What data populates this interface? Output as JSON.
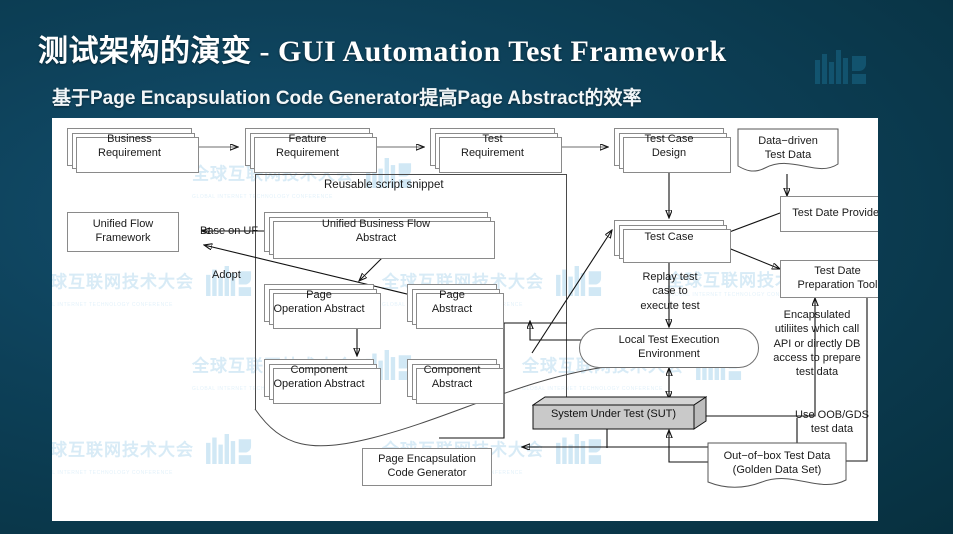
{
  "slide": {
    "title": "测试架构的演变 -  GUI Automation Test Framework",
    "subtitle": "基于Page Encapsulation Code Generator提高Page Abstract的效率",
    "background_color": "#0c3e52",
    "panel_color": "#ffffff",
    "watermark_text": "全球互联网技术大会",
    "watermark_subtext": "GLOBAL INTERNET TECHNOLOGY CONFERENCE"
  },
  "diagram": {
    "type": "flowchart",
    "group_label": "Reusable script snippet",
    "nodes": {
      "business_requirement": "Business\nRequirement",
      "feature_requirement": "Feature\nRequirement",
      "test_requirement": "Test\nRequirement",
      "test_case_design": "Test Case\nDesign",
      "data_driven_test_data": "Data−driven\nTest Data",
      "unified_flow_framework": "Unified Flow\nFramework",
      "unified_business_flow_abstract": "Unified Business Flow\nAbstract",
      "test_case": "Test Case",
      "test_date_provider": "Test Date Provider",
      "page_operation_abstract": "Page\nOperation Abstract",
      "page_abstract": "Page\nAbstract",
      "test_date_preparation_tool": "Test Date\nPreparation Tool",
      "component_operation_abstract": "Component\nOperation Abstract",
      "component_abstract": "Component\nAbstract",
      "local_test_execution_environment": "Local Test Execution\nEnvironment",
      "system_under_test": "System Under Test (SUT)",
      "page_encapsulation_code_generator": "Page Encapsulation\nCode Generator",
      "out_of_box_test_data": "Out−of−box Test Data\n(Golden Data Set)"
    },
    "annotations": {
      "base_on_uf": "Base on UF",
      "adopt": "Adopt",
      "replay_test": "Replay test\ncase to\nexecute test",
      "encapsulated_utilities": "Encapsulated\nutiliites which call\nAPI or directly DB\naccess to prepare\ntest data",
      "use_oob_gds": "Use OOB/GDS\ntest data"
    }
  }
}
